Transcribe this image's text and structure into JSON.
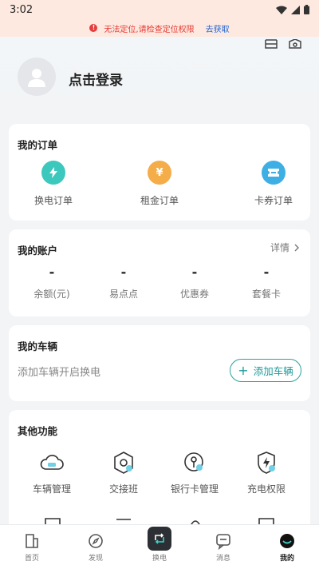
{
  "status_bar": {
    "time": "3:02"
  },
  "banner": {
    "message": "无法定位,请检查定位权限",
    "action": "去获取"
  },
  "profile": {
    "login_text": "点击登录"
  },
  "orders": {
    "title": "我的订单",
    "items": [
      {
        "label": "换电订单",
        "icon": "lightning-icon",
        "color": "#38c7bb"
      },
      {
        "label": "租金订单",
        "icon": "yuan-icon",
        "color": "#f3ae4a"
      },
      {
        "label": "卡券订单",
        "icon": "ticket-icon",
        "color": "#3daee3"
      }
    ]
  },
  "account": {
    "title": "我的账户",
    "detail": "详情",
    "items": [
      {
        "value": "-",
        "label": "余额(元)"
      },
      {
        "value": "-",
        "label": "易点点"
      },
      {
        "value": "-",
        "label": "优惠券"
      },
      {
        "value": "-",
        "label": "套餐卡"
      }
    ]
  },
  "vehicle": {
    "title": "我的车辆",
    "prompt": "添加车辆开启换电",
    "button": "添加车辆",
    "accent": "#2ba3a0"
  },
  "other": {
    "title": "其他功能",
    "items": [
      {
        "label": "车辆管理",
        "icon": "cloud-car-icon"
      },
      {
        "label": "交接班",
        "icon": "shift-icon"
      },
      {
        "label": "银行卡管理",
        "icon": "bank-card-icon"
      },
      {
        "label": "充电权限",
        "icon": "charge-shield-icon"
      }
    ]
  },
  "nav": {
    "items": [
      {
        "label": "首页",
        "icon": "home-icon"
      },
      {
        "label": "发现",
        "icon": "compass-icon"
      },
      {
        "label": "换电",
        "icon": "swap-icon"
      },
      {
        "label": "消息",
        "icon": "message-icon"
      },
      {
        "label": "我的",
        "icon": "profile-icon",
        "active": true
      }
    ]
  }
}
